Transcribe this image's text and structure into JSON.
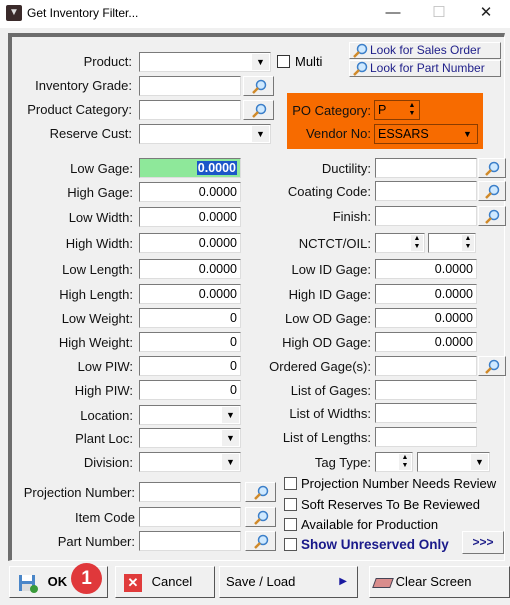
{
  "window": {
    "title": "Get Inventory Filter...",
    "minimize": "—",
    "maximize": "☐",
    "close": "✕"
  },
  "top": {
    "product": {
      "label": "Product:",
      "value": ""
    },
    "multi": {
      "label": "Multi",
      "checked": false
    },
    "inventory_grade": {
      "label": "Inventory Grade:",
      "value": ""
    },
    "product_category": {
      "label": "Product Category:",
      "value": ""
    },
    "reserve_cust": {
      "label": "Reserve Cust:",
      "value": ""
    },
    "look_sales_order": "Look for Sales Order",
    "look_part_number": "Look for Part Number",
    "po_category": {
      "label": "PO Category:",
      "value": "P"
    },
    "vendor_no": {
      "label": "Vendor No:",
      "value": "ESSARS"
    },
    "accent_color": "#f76b00"
  },
  "left_fields": [
    {
      "label": "Low Gage:",
      "value": "0.0000",
      "type": "text",
      "highlight": true
    },
    {
      "label": "High Gage:",
      "value": "0.0000",
      "type": "text"
    },
    {
      "label": "Low Width:",
      "value": "0.0000",
      "type": "text"
    },
    {
      "label": "High Width:",
      "value": "0.0000",
      "type": "text"
    },
    {
      "label": "Low Length:",
      "value": "0.0000",
      "type": "text"
    },
    {
      "label": "High Length:",
      "value": "0.0000",
      "type": "text"
    },
    {
      "label": "Low Weight:",
      "value": "0",
      "type": "text"
    },
    {
      "label": "High Weight:",
      "value": "0",
      "type": "text"
    },
    {
      "label": "Low PIW:",
      "value": "0",
      "type": "text"
    },
    {
      "label": "High PIW:",
      "value": "0",
      "type": "text"
    },
    {
      "label": "Location:",
      "value": "",
      "type": "combo"
    },
    {
      "label": "Plant Loc:",
      "value": "",
      "type": "combo"
    },
    {
      "label": "Division:",
      "value": "",
      "type": "combo"
    }
  ],
  "right_fields": [
    {
      "label": "Ductility:",
      "value": "",
      "type": "lookup"
    },
    {
      "label": "Coating Code:",
      "value": "",
      "type": "lookup"
    },
    {
      "label": "Finish:",
      "value": "",
      "type": "lookup"
    },
    {
      "label": "NCTCT/OIL:",
      "value": "",
      "type": "spins"
    },
    {
      "label": "Low ID Gage:",
      "value": "0.0000",
      "type": "text"
    },
    {
      "label": "High ID Gage:",
      "value": "0.0000",
      "type": "text"
    },
    {
      "label": "Low OD Gage:",
      "value": "0.0000",
      "type": "text"
    },
    {
      "label": "High OD Gage:",
      "value": "0.0000",
      "type": "text"
    },
    {
      "label": "Ordered Gage(s):",
      "value": "",
      "type": "lookup"
    },
    {
      "label": "List of Gages:",
      "value": "",
      "type": "text"
    },
    {
      "label": "List of Widths:",
      "value": "",
      "type": "text"
    },
    {
      "label": "List of Lengths:",
      "value": "",
      "type": "text"
    },
    {
      "label": "Tag Type:",
      "value": "",
      "type": "spincombo"
    }
  ],
  "bottom_fields": [
    {
      "label": "Projection Number:",
      "value": ""
    },
    {
      "label": "Item Code",
      "value": ""
    },
    {
      "label": "Part Number:",
      "value": ""
    }
  ],
  "checkboxes": [
    {
      "label": "Projection Number Needs Review",
      "checked": false
    },
    {
      "label": "Soft Reserves To Be Reviewed",
      "checked": false
    },
    {
      "label": "Available for Production",
      "checked": false
    },
    {
      "label": "Show Unreserved Only",
      "checked": false,
      "bold": true
    }
  ],
  "more_button": ">>>",
  "buttons": {
    "ok": "OK",
    "cancel": "Cancel",
    "save_load": "Save / Load",
    "clear": "Clear Screen"
  },
  "badge": "1"
}
